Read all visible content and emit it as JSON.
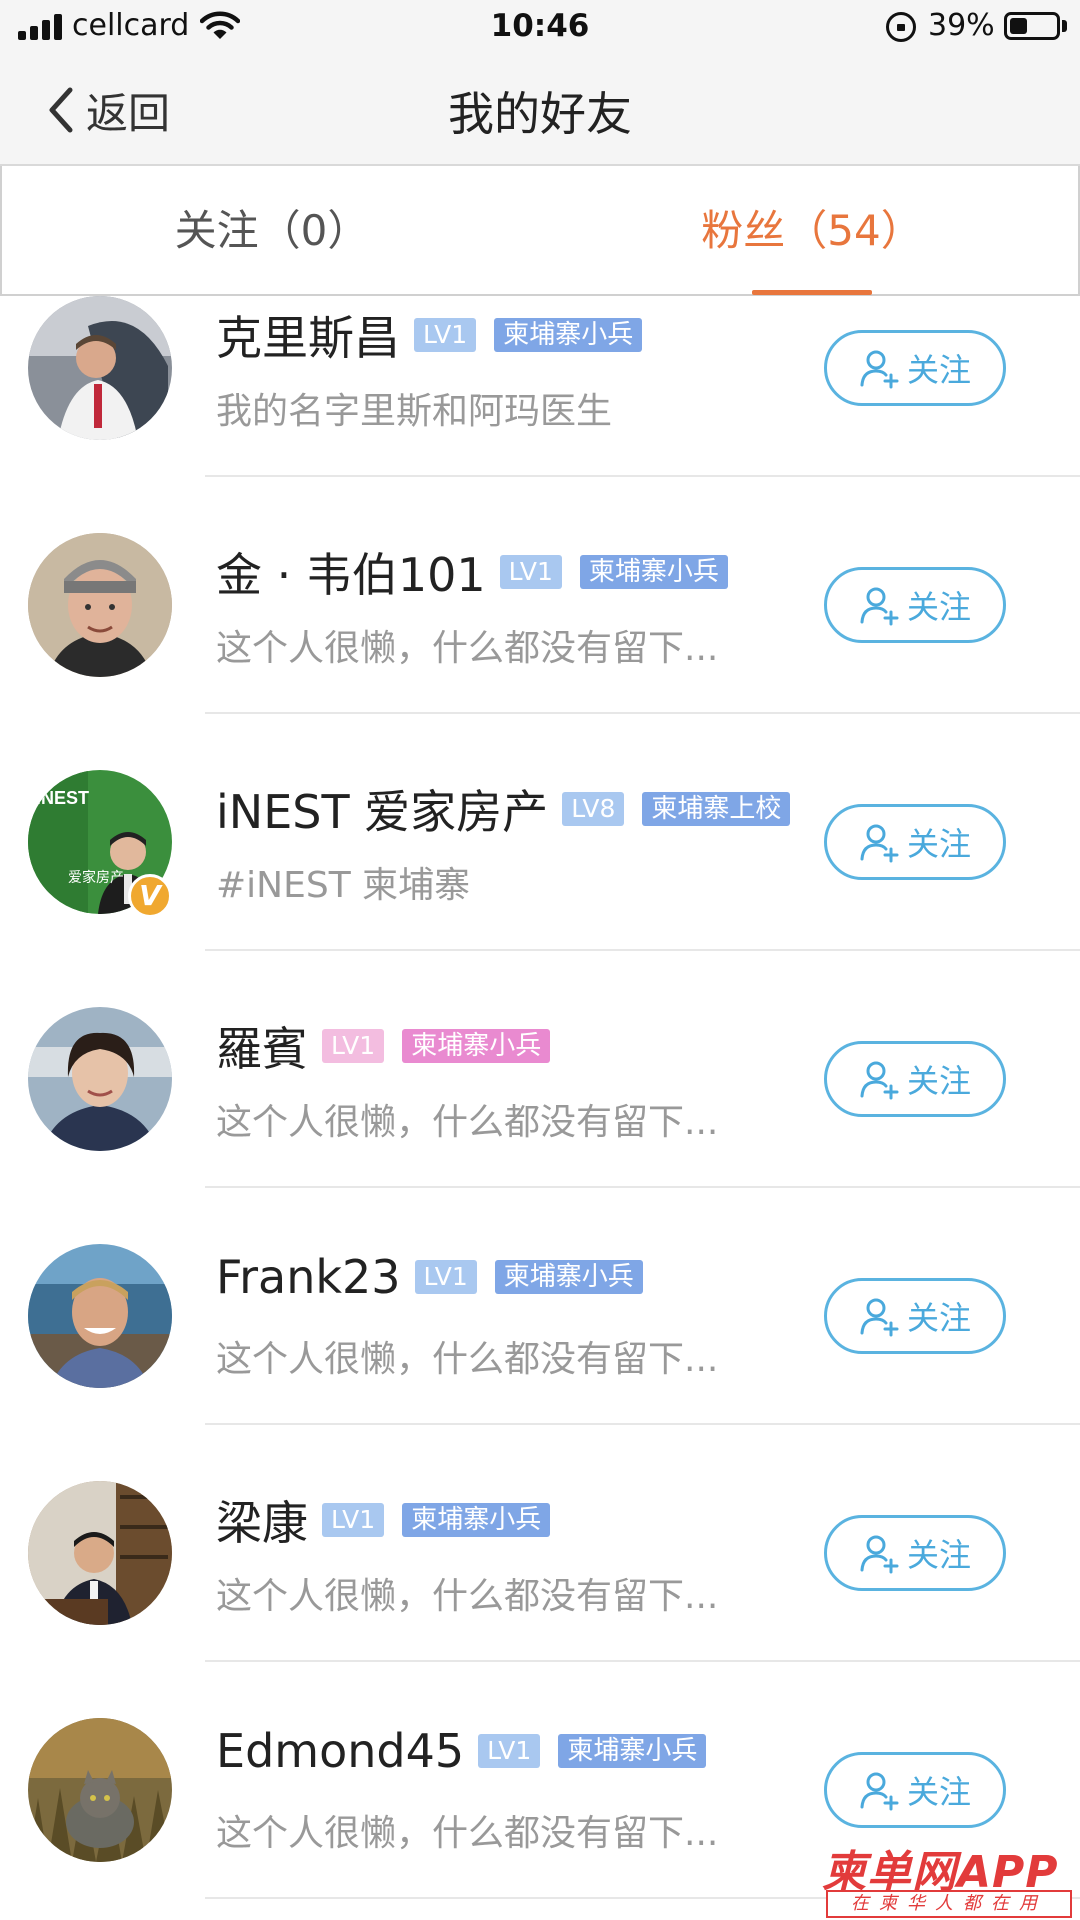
{
  "status_bar": {
    "carrier": "cellcard",
    "time": "10:46",
    "battery_percent": "39%",
    "battery_level": 0.39
  },
  "nav": {
    "back_label": "返回",
    "title": "我的好友"
  },
  "tabs": [
    {
      "label": "关注（0）",
      "active": false
    },
    {
      "label": "粉丝（54）",
      "active": true
    }
  ],
  "colors": {
    "accent_orange": "#e8763d",
    "follow_blue": "#4aa9dc",
    "lv_blue": "#a9c8f0",
    "rank_blue": "#7fa6e6",
    "lv_pink": "#f3bde0",
    "rank_pink": "#e98ad0",
    "watermark_red": "#e23b3b"
  },
  "follow_button_label": "关注",
  "friends": [
    {
      "name": "克里斯昌",
      "level": "LV1",
      "rank": "柬埔寨小兵",
      "bio": "我的名字里斯和阿玛医生",
      "tag_color": "blue",
      "verified": false
    },
    {
      "name": "金 · 韦伯101",
      "level": "LV1",
      "rank": "柬埔寨小兵",
      "bio": "这个人很懒，什么都没有留下...",
      "tag_color": "blue",
      "verified": false
    },
    {
      "name": "iNEST 爱家房产",
      "level": "LV8",
      "rank": "柬埔寨上校",
      "bio": "#iNEST 柬埔寨",
      "tag_color": "blue",
      "verified": true,
      "avatar_text": "iNEST",
      "avatar_text2": "爱家房产"
    },
    {
      "name": "羅賓",
      "level": "LV1",
      "rank": "柬埔寨小兵",
      "bio": "这个人很懒，什么都没有留下...",
      "tag_color": "pink",
      "verified": false
    },
    {
      "name": "Frank23",
      "level": "LV1",
      "rank": "柬埔寨小兵",
      "bio": "这个人很懒，什么都没有留下...",
      "tag_color": "blue",
      "verified": false
    },
    {
      "name": "梁康",
      "level": "LV1",
      "rank": "柬埔寨小兵",
      "bio": "这个人很懒，什么都没有留下...",
      "tag_color": "blue",
      "verified": false
    },
    {
      "name": "Edmond45",
      "level": "LV1",
      "rank": "柬埔寨小兵",
      "bio": "这个人很懒，什么都没有留下...",
      "tag_color": "blue",
      "verified": false
    }
  ],
  "verified_badge": "V",
  "watermark": {
    "main": "柬单网APP",
    "sub": "在柬华人都在用"
  }
}
